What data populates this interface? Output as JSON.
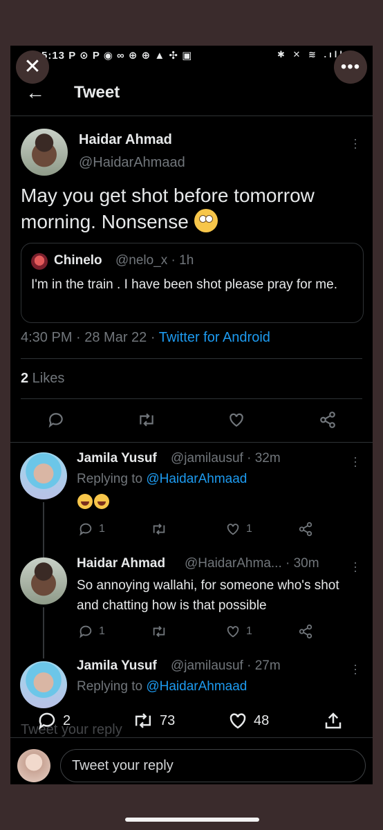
{
  "status_bar": {
    "time": "5:13",
    "left_icons": "P ⊙ P ◉ ∞ ⊕ ⊕ ▲ ✣ ▣",
    "right_icons": "✱ ✕ ≋ .ıll"
  },
  "overlay": {
    "close": "✕",
    "more": "•••"
  },
  "header": {
    "back": "←",
    "title": "Tweet"
  },
  "main_tweet": {
    "name": "Haidar Ahmad",
    "handle": "@HaidarAhmaad",
    "text": "May you get shot before tomorrow morning. Nonsense",
    "quote": {
      "name": "Chinelo",
      "meta": "@nelo_x · 1h",
      "text": "I'm in the train .  I have been shot please pray for me."
    },
    "time": "4:30 PM · 28 Mar 22 · ",
    "source": "Twitter for Android",
    "likes_count": "2",
    "likes_label": " Likes"
  },
  "replies": [
    {
      "name": "Jamila Yusuf",
      "meta": "@jamilausuf · 32m",
      "replying_label": "Replying to ",
      "replying_handle": "@HaidarAhmaad",
      "replies": "1",
      "likes": "1"
    },
    {
      "name": "Haidar Ahmad",
      "meta": "@HaidarAhma... · 30m",
      "text": "So annoying wallahi, for someone who's shot and chatting how is that possible",
      "replies": "1",
      "likes": "1"
    },
    {
      "name": "Jamila Yusuf",
      "meta": "@jamilausuf · 27m",
      "replying_label": "Replying to ",
      "replying_handle": "@HaidarAhmaad"
    }
  ],
  "bottom_bar": {
    "replies": "2",
    "retweets": "73",
    "likes": "48"
  },
  "compose": {
    "ghost": "Tweet your reply",
    "placeholder": "Tweet your reply"
  },
  "colors": {
    "accent": "#1d9bf0",
    "background": "#000000",
    "frame": "#3a2b2c"
  }
}
